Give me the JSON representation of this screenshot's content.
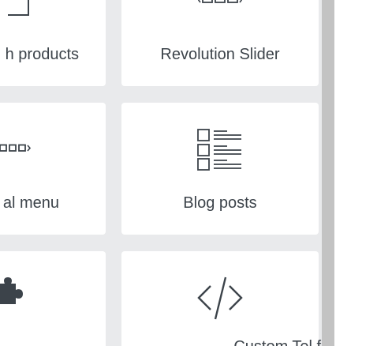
{
  "cards": [
    {
      "label": "h products",
      "icon": "products-icon"
    },
    {
      "label": "Revolution Slider",
      "icon": "slider-icon"
    },
    {
      "label": "al menu",
      "icon": "menu-icon"
    },
    {
      "label": "Blog posts",
      "icon": "blog-posts-icon"
    },
    {
      "label": "",
      "icon": "puzzle-icon"
    },
    {
      "label": "Custom Tel fil",
      "icon": "code-icon"
    }
  ],
  "colors": {
    "panel_background": "#e9eaec",
    "card_background": "#ffffff",
    "text": "#3c434a",
    "icon": "#3c434a",
    "scrollbar": "#c7c7c7"
  }
}
